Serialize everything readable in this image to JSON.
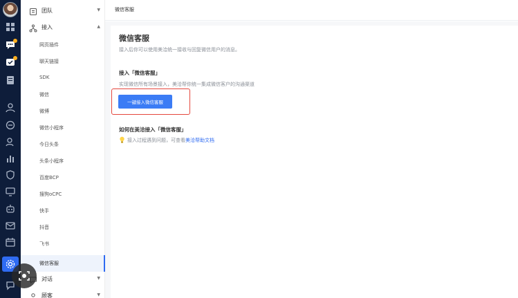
{
  "topbar": {
    "title": "微信客服"
  },
  "sidebar": {
    "groups": [
      {
        "label": "团队",
        "icon": "team-icon",
        "caret": "▼"
      },
      {
        "label": "接入",
        "icon": "access-icon",
        "caret": "▲"
      },
      {
        "label": "对话",
        "icon": "chat-icon",
        "caret": "▼"
      },
      {
        "label": "顾客",
        "icon": "customer-icon",
        "caret": "▼"
      }
    ],
    "items": [
      "网页插件",
      "聊天链接",
      "SDK",
      "微信",
      "微博",
      "微信小程序",
      "今日头条",
      "头条小程序",
      "百度BCP",
      "搜狗oCPC",
      "快手",
      "抖音",
      "飞书",
      "微信客服"
    ],
    "active_item": "微信客服"
  },
  "main": {
    "title": "微信客服",
    "description": "接入后你可以使用美洽统一接收与回复微信用户的消息。",
    "section_connect": {
      "title": "接入「微信客服」",
      "description": "实现微信所有场景接入，美洽帮你统一集成微信客户的沟通渠道",
      "button_label": "一键接入微信客服"
    },
    "section_help": {
      "title": "如何在美洽接入「微信客服」",
      "text": "接入过程遇到问题，可查看",
      "link": "美洽帮助文档"
    }
  },
  "colors": {
    "accent": "#2f6bf2",
    "rail": "#0e1d3a",
    "highlight_outline": "#e4453b",
    "badge": "#ffb020"
  }
}
